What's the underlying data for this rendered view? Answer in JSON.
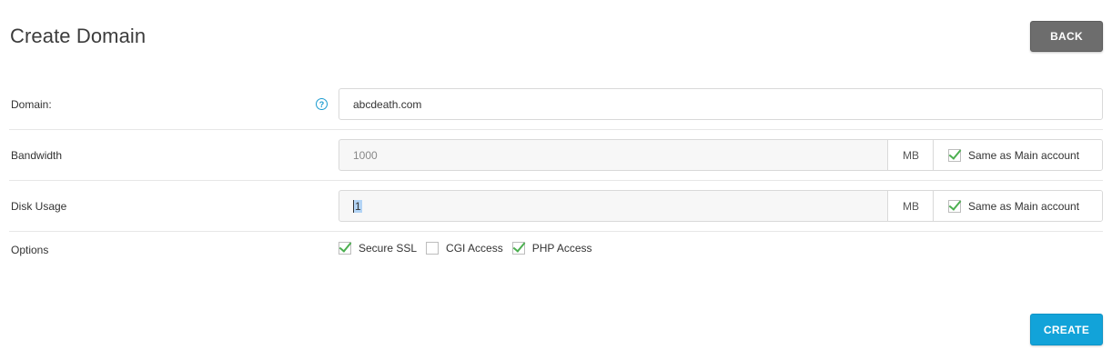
{
  "header": {
    "title": "Create Domain",
    "back_label": "BACK"
  },
  "form": {
    "domain": {
      "label": "Domain:",
      "value": "abcdeath.com",
      "help_icon": "question-circle-icon"
    },
    "bandwidth": {
      "label": "Bandwidth",
      "value": "1000",
      "unit": "MB",
      "same_label": "Same as Main account",
      "same_checked": true
    },
    "disk_usage": {
      "label": "Disk Usage",
      "value": "1",
      "unit": "MB",
      "same_label": "Same as Main account",
      "same_checked": true
    },
    "options": {
      "label": "Options",
      "items": [
        {
          "label": "Secure SSL",
          "checked": true
        },
        {
          "label": "CGI Access",
          "checked": false
        },
        {
          "label": "PHP Access",
          "checked": true
        }
      ]
    }
  },
  "footer": {
    "create_label": "CREATE"
  },
  "colors": {
    "primary": "#12a3d9",
    "back_button": "#6d6d6d",
    "check": "#4caf50",
    "help": "#1a9bd0"
  }
}
